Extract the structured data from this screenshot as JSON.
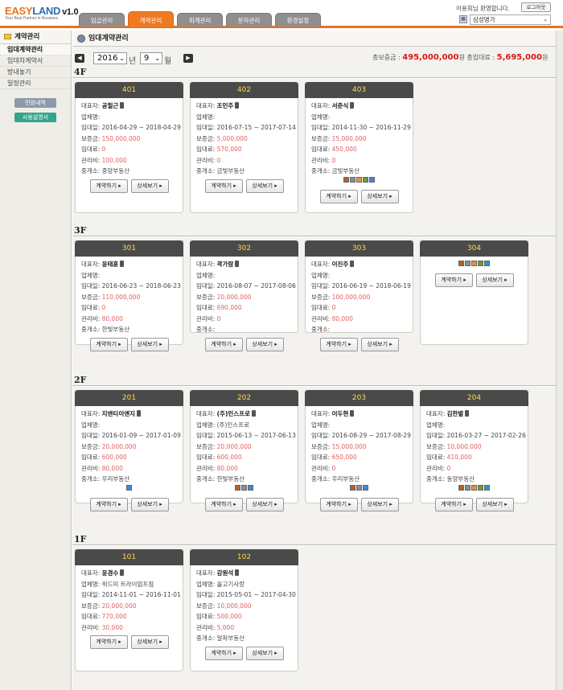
{
  "header": {
    "logo_easy": "EASY",
    "logo_land": "LAND",
    "version": "v1.0",
    "slogan": "Your Best Partner in Business",
    "greeting": "이용회님 환영합니다.",
    "logout_label": "로그아웃",
    "building_select": "삼성명가",
    "tabs": [
      {
        "label": "임급관리"
      },
      {
        "label": "계약관리",
        "active": true
      },
      {
        "label": "회계관리"
      },
      {
        "label": "문자관리"
      },
      {
        "label": "환경설정"
      }
    ]
  },
  "sidebar": {
    "title": "계약관리",
    "items": [
      {
        "label": "임대계약관리",
        "active": true
      },
      {
        "label": "임대차계약서"
      },
      {
        "label": "방내놓기"
      },
      {
        "label": "일정관리"
      }
    ],
    "buttons": {
      "complaint": "민원내역",
      "manual": "사용설명서"
    }
  },
  "main": {
    "title": "임대계약관리",
    "year": "2016",
    "year_unit": "년",
    "month": "9",
    "month_unit": "월",
    "total_deposit_label": "총보증금 :",
    "total_deposit": "495,000,000",
    "total_deposit_unit": "원",
    "total_rent_label": "총임대료 :",
    "total_rent": "5,695,000",
    "total_rent_unit": "원"
  },
  "labels": {
    "rep": "대표자:",
    "biz": "업체명:",
    "period": "임대일:",
    "deposit": "보증금:",
    "rent": "임대료:",
    "mgmt": "관리비:",
    "agent": "중개소:",
    "contract_btn": "계약하기 ▸",
    "detail_btn": "상세보기 ▸"
  },
  "floors": [
    {
      "name": "4F",
      "units": [
        {
          "no": "401",
          "rep": "공필근",
          "biz": "",
          "period": "2016-04-29 ~ 2018-04-29",
          "deposit": "150,000,000",
          "rent": "0",
          "mgmt": "100,000",
          "agent": "중앙부동산",
          "icons": []
        },
        {
          "no": "402",
          "rep": "조인주",
          "biz": "",
          "period": "2016-07-15 ~ 2017-07-14",
          "deposit": "5,000,000",
          "rent": "570,000",
          "mgmt": "0",
          "agent": "금빛부동산",
          "icons": []
        },
        {
          "no": "403",
          "rep": "서준식",
          "biz": "",
          "period": "2014-11-30 ~ 2016-11-29",
          "deposit": "15,000,000",
          "rent": "450,000",
          "mgmt": "0",
          "agent": "금빛부동산",
          "icons": [
            "ic1",
            "ic2",
            "ic3",
            "ic4",
            "ic5"
          ]
        }
      ]
    },
    {
      "name": "3F",
      "units": [
        {
          "no": "301",
          "rep": "윤태훈",
          "biz": "",
          "period": "2016-06-23 ~ 2018-06-23",
          "deposit": "110,000,000",
          "rent": "0",
          "mgmt": "80,000",
          "agent": "한빛부동산",
          "icons": []
        },
        {
          "no": "302",
          "rep": "곽가람",
          "biz": "",
          "period": "2016-08-07 ~ 2017-08-06",
          "deposit": "20,000,000",
          "rent": "690,000",
          "mgmt": "0",
          "agent": "",
          "icons": []
        },
        {
          "no": "303",
          "rep": "이진주",
          "biz": "",
          "period": "2016-06-19 ~ 2018-06-19",
          "deposit": "100,000,000",
          "rent": "0",
          "mgmt": "80,000",
          "agent": "",
          "icons": []
        },
        {
          "no": "304",
          "empty": true,
          "icons": [
            "ic1",
            "ic2",
            "ic3",
            "ic4",
            "ic5"
          ]
        }
      ]
    },
    {
      "name": "2F",
      "units": [
        {
          "no": "201",
          "rep": "지엔티이엔지",
          "biz": "",
          "period": "2016-01-09 ~ 2017-01-09",
          "deposit": "20,000,000",
          "rent": "600,000",
          "mgmt": "80,000",
          "agent": "우리부동산",
          "icons": [
            "ic5"
          ]
        },
        {
          "no": "202",
          "rep": "(주)인스프로",
          "biz": "(주)인스프로",
          "period": "2015-06-13 ~ 2017-06-13",
          "deposit": "20,000,000",
          "rent": "600,000",
          "mgmt": "80,000",
          "agent": "한빛부동산",
          "icons": [
            "ic1",
            "ic2",
            "ic5"
          ]
        },
        {
          "no": "203",
          "rep": "이두현",
          "biz": "",
          "period": "2016-08-29 ~ 2017-08-29",
          "deposit": "15,000,000",
          "rent": "650,000",
          "mgmt": "0",
          "agent": "우리부동산",
          "icons": [
            "ic1",
            "ic2",
            "ic5"
          ]
        },
        {
          "no": "204",
          "rep": "김한별",
          "biz": "",
          "period": "2016-03-27 ~ 2017-02-26",
          "deposit": "10,000,000",
          "rent": "410,000",
          "mgmt": "0",
          "agent": "동양부동산",
          "icons": [
            "ic1",
            "ic2",
            "ic3",
            "ic4",
            "ic5"
          ]
        }
      ]
    },
    {
      "name": "1F",
      "units": [
        {
          "no": "101",
          "rep": "윤경수",
          "biz": "위드미 트라이엄프점",
          "period": "2014-11-01 ~ 2016-11-01",
          "deposit": "20,000,000",
          "rent": "770,000",
          "mgmt": "30,000",
          "agent": null,
          "icons": []
        },
        {
          "no": "102",
          "rep": "강원석",
          "biz": "올고기사랑",
          "period": "2015-05-01 ~ 2017-04-30",
          "deposit": "10,000,000",
          "rent": "500,000",
          "mgmt": "5,000",
          "agent": "알파부동산",
          "icons": []
        }
      ]
    }
  ]
}
